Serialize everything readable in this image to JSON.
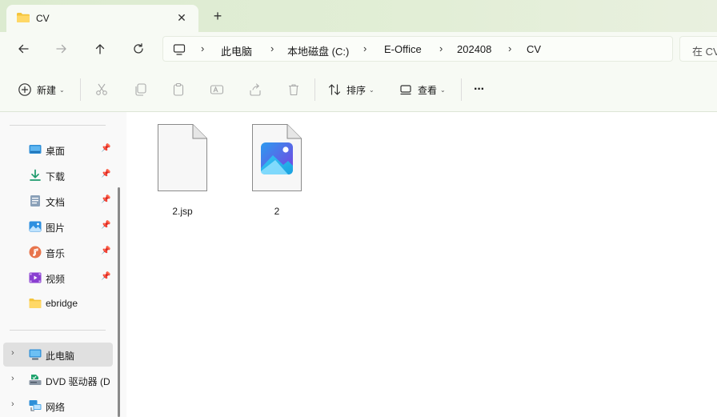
{
  "tab": {
    "title": "CV",
    "close": "✕",
    "new_tab": "+"
  },
  "address": {
    "crumbs": [
      "此电脑",
      "本地磁盘 (C:)",
      "E-Office",
      "202408",
      "CV"
    ],
    "separator": "›",
    "search_placeholder": "在 CV"
  },
  "toolbar": {
    "new_label": "新建",
    "sort_label": "排序",
    "view_label": "查看",
    "more_label": "···"
  },
  "sidebar": {
    "quick_access": [
      {
        "label": "桌面",
        "icon": "desktop-icon",
        "pinned": true
      },
      {
        "label": "下载",
        "icon": "download-icon",
        "pinned": true
      },
      {
        "label": "文档",
        "icon": "documents-icon",
        "pinned": true
      },
      {
        "label": "图片",
        "icon": "pictures-icon",
        "pinned": true
      },
      {
        "label": "音乐",
        "icon": "music-icon",
        "pinned": true
      },
      {
        "label": "视频",
        "icon": "videos-icon",
        "pinned": true
      },
      {
        "label": "ebridge",
        "icon": "folder-icon",
        "pinned": false
      }
    ],
    "devices": [
      {
        "label": "此电脑",
        "icon": "this-pc-icon",
        "selected": true
      },
      {
        "label": "DVD 驱动器 (D",
        "icon": "dvd-drive-icon",
        "selected": false
      },
      {
        "label": "网络",
        "icon": "network-icon",
        "selected": false
      }
    ]
  },
  "files": [
    {
      "name": "2.jsp",
      "type": "generic-file-icon"
    },
    {
      "name": "2",
      "type": "image-file-icon"
    }
  ],
  "colors": {
    "accent": "#0067c0",
    "folder": "#f4c43b",
    "chrome_bg": "#e4efd9"
  }
}
